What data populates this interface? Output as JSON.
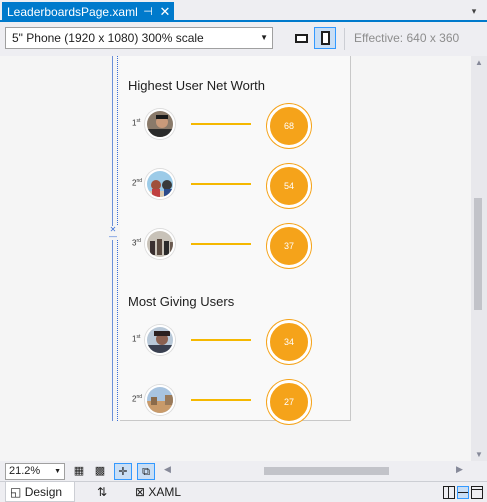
{
  "tab": {
    "title": "LeaderboardsPage.xaml",
    "pin_glyph": "⊣",
    "close_glyph": "✕",
    "dropdown_glyph": "▾"
  },
  "toolbar": {
    "device": "5\" Phone (1920 x 1080) 300% scale",
    "effective": "Effective: 640 x 360"
  },
  "leaderboards": {
    "sections": [
      {
        "title": "Highest User Net Worth",
        "rows": [
          {
            "rank": "1",
            "suffix": "st",
            "score": "68"
          },
          {
            "rank": "2",
            "suffix": "nd",
            "score": "54"
          },
          {
            "rank": "3",
            "suffix": "rd",
            "score": "37"
          }
        ]
      },
      {
        "title": "Most Giving Users",
        "rows": [
          {
            "rank": "1",
            "suffix": "st",
            "score": "34"
          },
          {
            "rank": "2",
            "suffix": "nd",
            "score": "27"
          }
        ]
      }
    ]
  },
  "bottom": {
    "zoom": "21.2%"
  },
  "views": {
    "design": "Design",
    "xaml": "XAML"
  },
  "colors": {
    "accent": "#007acc",
    "score": "#f5a31a",
    "connector": "#f5b800"
  }
}
